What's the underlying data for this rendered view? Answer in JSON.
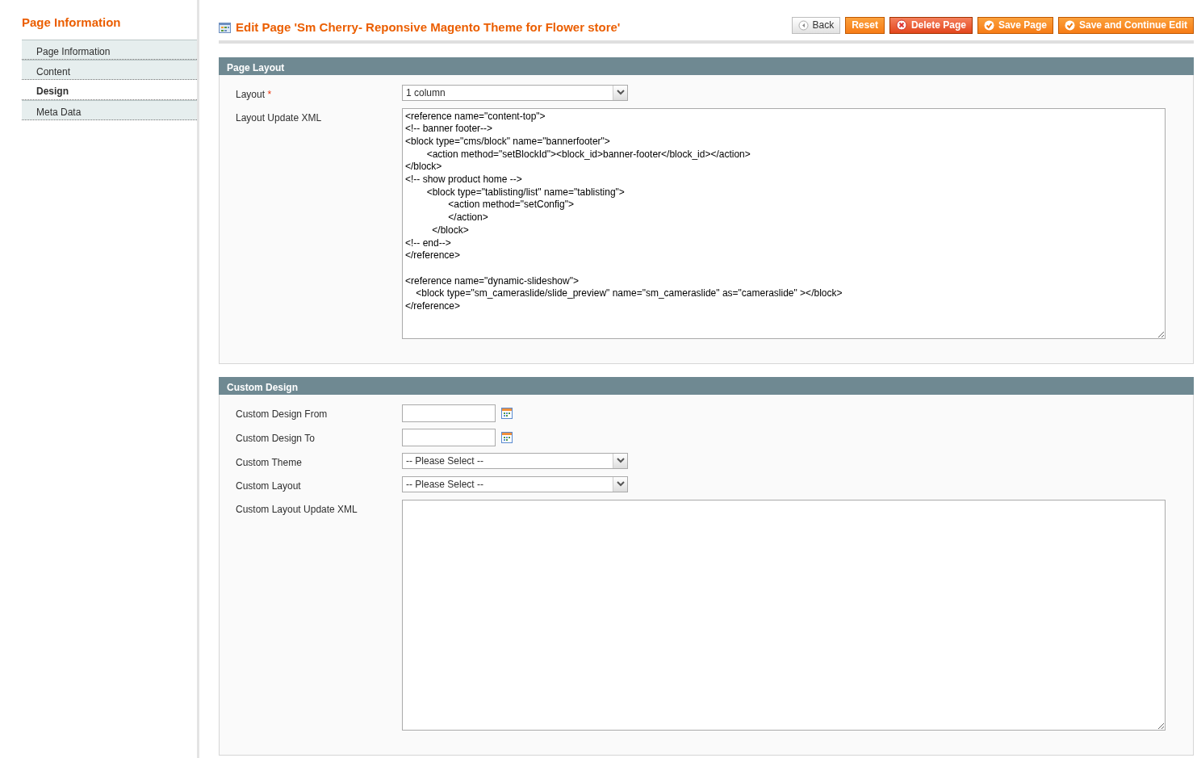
{
  "sidebar": {
    "title": "Page Information",
    "items": [
      {
        "label": "Page Information",
        "selected": false
      },
      {
        "label": "Content",
        "selected": false
      },
      {
        "label": "Design",
        "selected": true
      },
      {
        "label": "Meta Data",
        "selected": false
      }
    ]
  },
  "header": {
    "title": "Edit Page 'Sm Cherry- Reponsive Magento Theme for Flower store'",
    "buttons": [
      {
        "label": "Back",
        "kind": "back"
      },
      {
        "label": "Reset",
        "kind": "plain"
      },
      {
        "label": "Delete Page",
        "kind": "delete"
      },
      {
        "label": "Save Page",
        "kind": "save"
      },
      {
        "label": "Save and Continue Edit",
        "kind": "save"
      }
    ]
  },
  "sections": [
    {
      "title": "Page Layout",
      "fields": [
        {
          "label": "Layout",
          "required_mark": "*",
          "kind": "select",
          "value": "1 column"
        },
        {
          "label": "Layout Update XML",
          "kind": "textarea",
          "value": "<reference name=\"content-top\">\n<!-- banner footer-->\n<block type=\"cms/block\" name=\"bannerfooter\">\n\t\t<action method=\"setBlockId\"><block_id>banner-footer</block_id></action>\n</block>\n<!-- show product home -->\n\t\t<block type=\"tablisting/list\" name=\"tablisting\">\n\t\t\t\t<action method=\"setConfig\">\n\t\t\t\t</action>\n\t\t  </block>\n<!-- end-->\n</reference>\n\n<reference name=\"dynamic-slideshow\">\n\t<block type=\"sm_cameraslide/slide_preview\" name=\"sm_cameraslide\" as=\"cameraslide\" ></block>\n</reference>"
        }
      ]
    },
    {
      "title": "Custom Design",
      "fields": [
        {
          "label": "Custom Design From",
          "kind": "date"
        },
        {
          "label": "Custom Design To",
          "kind": "date"
        },
        {
          "label": "Custom Theme",
          "kind": "select",
          "value": "-- Please Select --"
        },
        {
          "label": "Custom Layout",
          "kind": "select",
          "value": "-- Please Select --"
        },
        {
          "label": "Custom Layout Update XML",
          "kind": "textarea"
        }
      ]
    }
  ]
}
